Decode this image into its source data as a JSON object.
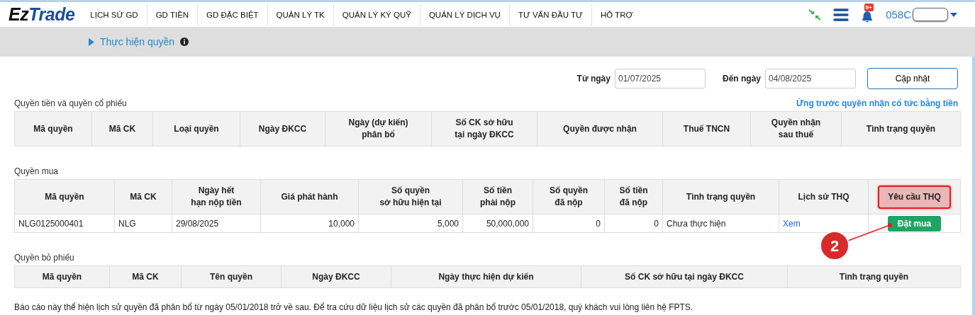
{
  "header": {
    "logo": {
      "part1": "Ez",
      "part2": "Trade"
    },
    "nav": [
      "LỊCH SỬ GD",
      "GD TIỀN",
      "GD ĐẶC BIỆT",
      "QUẢN LÝ TK",
      "QUẢN LÝ KÝ QUỸ",
      "QUẢN LÝ DỊCH VỤ",
      "TƯ VẤN ĐẦU TƯ",
      "HỖ TRỢ"
    ],
    "notification_badge": "9+",
    "account": "058C"
  },
  "breadcrumb": {
    "title": "Thực hiện quyền"
  },
  "filter": {
    "from_label": "Từ ngày",
    "from_value": "01/07/2025",
    "to_label": "Đến ngày",
    "to_value": "04/08/2025",
    "button": "Cập nhật"
  },
  "sections": [
    {
      "title": "Quyền tiền và quyền cổ phiếu",
      "link": "Ứng trước quyền nhận cổ tức bằng tiền",
      "columns": [
        {
          "label": "Mã quyền",
          "highlighted": false
        },
        {
          "label": "Mã CK",
          "highlighted": false
        },
        {
          "label": "Loại quyền",
          "highlighted": false
        },
        {
          "label": "Ngày ĐKCC",
          "highlighted": false
        },
        {
          "label": "Ngày (dự kiến)\nphân bổ",
          "highlighted": false
        },
        {
          "label": "Số CK sở hữu\ntại ngày ĐKCC",
          "highlighted": false
        },
        {
          "label": "Quyền được nhận",
          "highlighted": false
        },
        {
          "label": "Thuế TNCN",
          "highlighted": false
        },
        {
          "label": "Quyền nhận\nsau thuế",
          "highlighted": false
        },
        {
          "label": "Tình trạng quyền",
          "highlighted": false
        }
      ]
    },
    {
      "title": "Quyền mua",
      "columns": [
        {
          "label": "Mã quyền",
          "highlighted": false
        },
        {
          "label": "Mã CK",
          "highlighted": false
        },
        {
          "label": "Ngày hết\nhạn nộp tiền",
          "highlighted": false
        },
        {
          "label": "Giá phát hành",
          "highlighted": false
        },
        {
          "label": "Số quyền\nsở hữu hiện tại",
          "highlighted": false
        },
        {
          "label": "Số tiền\nphải nộp",
          "highlighted": false
        },
        {
          "label": "Số quyền\nđã nộp",
          "highlighted": false
        },
        {
          "label": "Số tiền\nđã nộp",
          "highlighted": false
        },
        {
          "label": "Tình trạng quyền",
          "highlighted": false
        },
        {
          "label": "Lịch sử THQ",
          "highlighted": false
        },
        {
          "label": "Yêu cầu THQ",
          "highlighted": true
        }
      ],
      "rows": [
        [
          {
            "kind": "text",
            "text": "NLG0125000401"
          },
          {
            "kind": "text",
            "text": "NLG"
          },
          {
            "kind": "text",
            "text": "29/08/2025"
          },
          {
            "kind": "number",
            "text": "10,000"
          },
          {
            "kind": "number",
            "text": "5,000"
          },
          {
            "kind": "number",
            "text": "50,000,000"
          },
          {
            "kind": "number",
            "text": "0"
          },
          {
            "kind": "number",
            "text": "0"
          },
          {
            "kind": "text",
            "text": "Chưa thực hiện"
          },
          {
            "kind": "link",
            "text": "Xem"
          },
          {
            "kind": "button",
            "text": "Đặt mua"
          }
        ]
      ]
    },
    {
      "title": "Quyền bỏ phiếu",
      "columns": [
        {
          "label": "Mã quyền",
          "highlighted": false
        },
        {
          "label": "Mã CK",
          "highlighted": false
        },
        {
          "label": "Tên quyền",
          "highlighted": false
        },
        {
          "label": "Ngày ĐKCC",
          "highlighted": false
        },
        {
          "label": "Ngày thực hiện dự kiến",
          "highlighted": false
        },
        {
          "label": "Số CK sở hữu tại ngày ĐKCC",
          "highlighted": false
        },
        {
          "label": "Tình trạng quyền",
          "highlighted": false
        }
      ]
    }
  ],
  "note": "Báo cáo này thể hiện lịch sử quyền đã phân bổ từ ngày 05/01/2018 trở về sau. Để tra cứu dữ liệu lịch sử các quyền đã phân bổ trước 05/01/2018, quý khách vui lòng liên hệ FPTS.",
  "callout": {
    "number": "2"
  }
}
